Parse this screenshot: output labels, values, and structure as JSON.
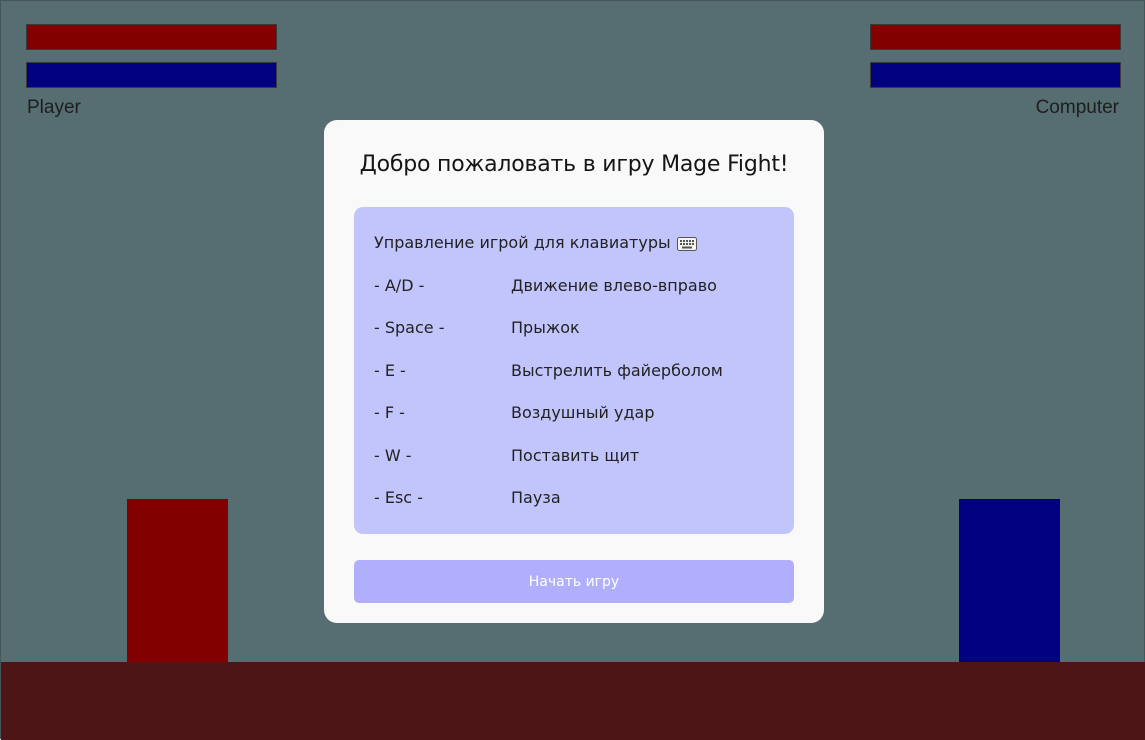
{
  "colors": {
    "background": "#566d72",
    "ground": "#4e1517",
    "player": "#820000",
    "computer": "#000081",
    "health_bar": "#820000",
    "mana_bar": "#000081",
    "modal_bg": "#f9f9fa",
    "controls_bg": "#c2c5fb",
    "start_button_bg": "#b1affd"
  },
  "hud": {
    "player": {
      "name": "Player",
      "health": 1.0,
      "mana": 1.0
    },
    "computer": {
      "name": "Computer",
      "health": 1.0,
      "mana": 1.0
    }
  },
  "modal": {
    "title": "Добро пожаловать в игру Mage Fight!",
    "controls_title": "Управление игрой для клавиатуры",
    "controls_icon": "keyboard-icon",
    "controls": [
      {
        "key": "- A/D -",
        "action": "Движение влево-вправо"
      },
      {
        "key": "- Space -",
        "action": "Прыжок"
      },
      {
        "key": "- E -",
        "action": "Выстрелить файерболом"
      },
      {
        "key": "- F -",
        "action": "Воздушный удар"
      },
      {
        "key": "- W -",
        "action": "Поставить щит"
      },
      {
        "key": "- Esc -",
        "action": "Пауза"
      }
    ],
    "start_label": "Начать игру"
  }
}
